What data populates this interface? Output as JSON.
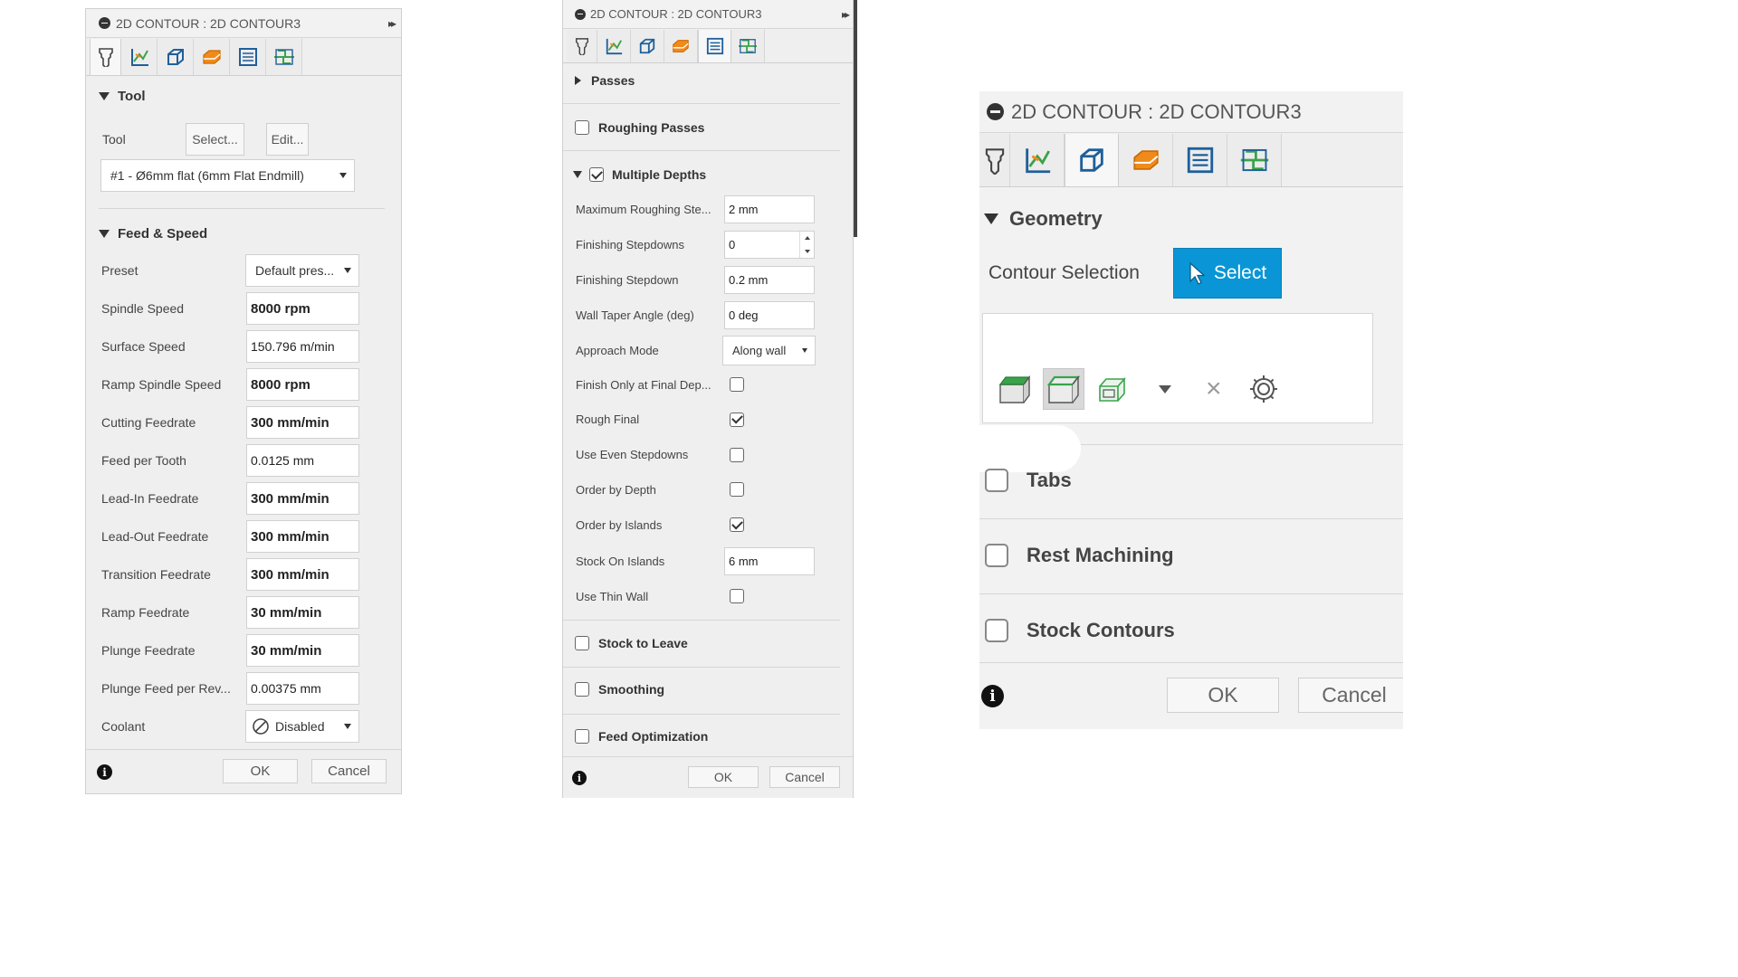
{
  "panel1": {
    "title": "2D CONTOUR : 2D CONTOUR3",
    "expand_label": "▸▸",
    "tabs": [
      "tool-icon",
      "heights-icon",
      "geometry-icon",
      "passes-icon",
      "linking-icon",
      "pattern-icon"
    ],
    "tool_section": {
      "header": "Tool",
      "tool_label": "Tool",
      "select_button": "Select...",
      "edit_button": "Edit...",
      "tool_value": "#1 - Ø6mm flat (6mm Flat Endmill)"
    },
    "feed_section": {
      "header": "Feed & Speed",
      "preset_label": "Preset",
      "preset_value": "Default pres...",
      "fields": [
        {
          "label": "Spindle Speed",
          "value": "8000 rpm"
        },
        {
          "label": "Surface Speed",
          "value": "150.796 m/min"
        },
        {
          "label": "Ramp Spindle Speed",
          "value": "8000 rpm"
        },
        {
          "label": "Cutting Feedrate",
          "value": "300 mm/min"
        },
        {
          "label": "Feed per Tooth",
          "value": "0.0125 mm"
        },
        {
          "label": "Lead-In Feedrate",
          "value": "300 mm/min"
        },
        {
          "label": "Lead-Out Feedrate",
          "value": "300 mm/min"
        },
        {
          "label": "Transition Feedrate",
          "value": "300 mm/min"
        },
        {
          "label": "Ramp Feedrate",
          "value": "30 mm/min"
        },
        {
          "label": "Plunge Feedrate",
          "value": "30 mm/min"
        },
        {
          "label": "Plunge Feed per Rev...",
          "value": "0.00375 mm"
        }
      ],
      "coolant_label": "Coolant",
      "coolant_value": "Disabled"
    },
    "ok": "OK",
    "cancel": "Cancel",
    "info": "i"
  },
  "panel2": {
    "title": "2D CONTOUR : 2D CONTOUR3",
    "expand_label": "▸▸",
    "passes_header": "Passes",
    "roughing_passes": "Roughing Passes",
    "multiple_depths": "Multiple Depths",
    "max_roughing_label": "Maximum Roughing Ste...",
    "max_roughing_value": "2 mm",
    "finishing_stepdowns_label": "Finishing Stepdowns",
    "finishing_stepdowns_value": "0",
    "finishing_stepdown_label": "Finishing Stepdown",
    "finishing_stepdown_value": "0.2 mm",
    "wall_taper_label": "Wall Taper Angle (deg)",
    "wall_taper_value": "0 deg",
    "approach_label": "Approach Mode",
    "approach_value": "Along wall",
    "checkbox_rows": [
      {
        "label": "Finish Only at Final Dep...",
        "checked": false
      },
      {
        "label": "Rough Final",
        "checked": true
      },
      {
        "label": "Use Even Stepdowns",
        "checked": false
      },
      {
        "label": "Order by Depth",
        "checked": false
      },
      {
        "label": "Order by Islands",
        "checked": true
      }
    ],
    "stock_islands_label": "Stock On Islands",
    "stock_islands_value": "6 mm",
    "thin_wall_label": "Use Thin Wall",
    "stock_to_leave": "Stock to Leave",
    "smoothing": "Smoothing",
    "feed_optimization": "Feed Optimization",
    "ok": "OK",
    "cancel": "Cancel",
    "info": "i"
  },
  "panel3": {
    "title": "2D CONTOUR : 2D CONTOUR3",
    "geometry_header": "Geometry",
    "contour_selection_label": "Contour Selection",
    "select_button": "Select",
    "tabs_label": "Tabs",
    "rest_machining_label": "Rest Machining",
    "stock_contours_label": "Stock Contours",
    "ok": "OK",
    "cancel": "Cancel",
    "info": "i"
  },
  "colors": {
    "select_blue": "#0a96d6",
    "orange_icon": "#f08a1a",
    "blue_icon": "#1f5f9a",
    "green_icon": "#3aa34a"
  }
}
